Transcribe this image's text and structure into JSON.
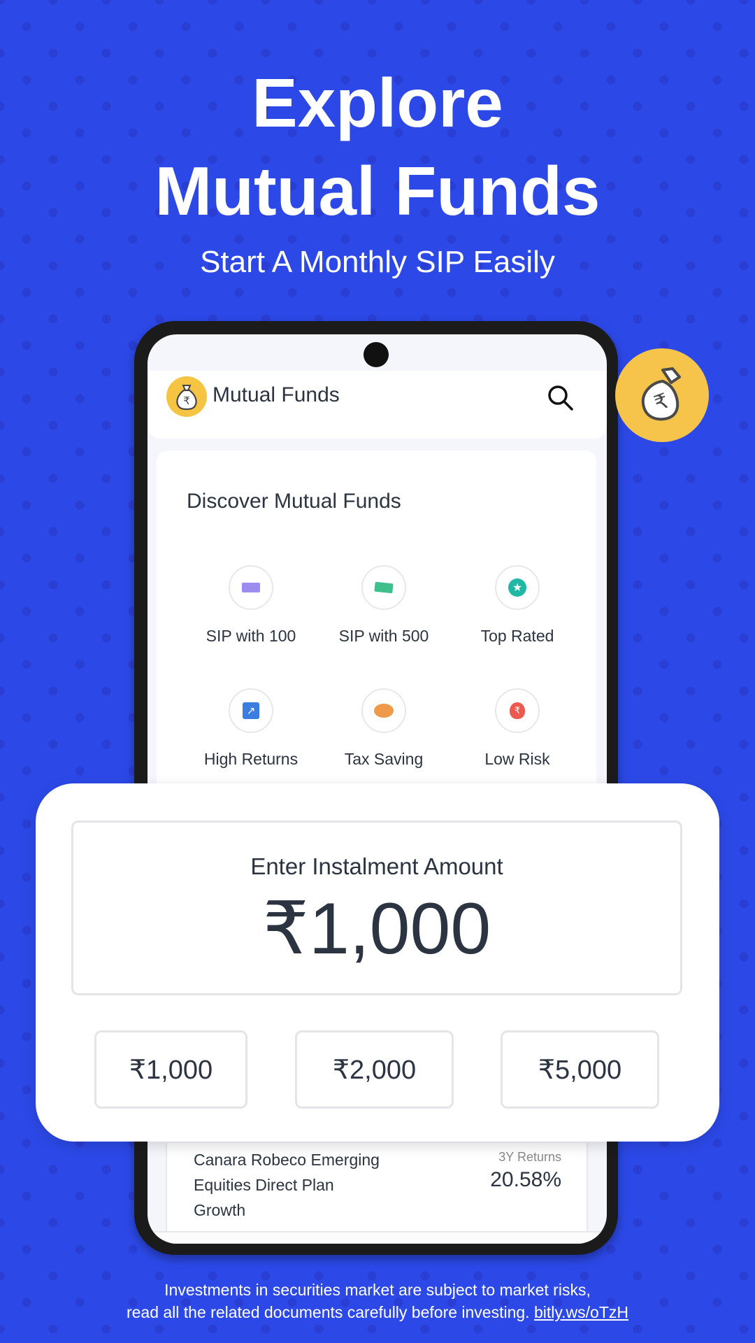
{
  "hero": {
    "title_line1": "Explore",
    "title_line2": "Mutual Funds",
    "subtitle": "Start A Monthly SIP Easily"
  },
  "app": {
    "title": "Mutual Funds",
    "discover_title": "Discover Mutual Funds",
    "categories": [
      {
        "label": "SIP with 100",
        "icon": "rupee-100-note-icon"
      },
      {
        "label": "SIP with 500",
        "icon": "rupee-500-note-icon"
      },
      {
        "label": "Top Rated",
        "icon": "star-badge-icon"
      },
      {
        "label": "High Returns",
        "icon": "trending-up-icon"
      },
      {
        "label": "Tax Saving",
        "icon": "piggy-bank-icon"
      },
      {
        "label": "Low Risk",
        "icon": "money-bag-icon"
      }
    ],
    "fund": {
      "name_line1": "Canara Robeco Emerging",
      "name_line2": "Equities Direct Plan",
      "name_line3": "Growth",
      "returns_label": "3Y Returns",
      "returns_value": "20.58%"
    }
  },
  "instalment": {
    "label": "Enter Instalment Amount",
    "amount": "₹1,000",
    "presets": [
      "₹1,000",
      "₹2,000",
      "₹5,000"
    ]
  },
  "disclaimer": {
    "line1": "Investments in securities market are subject to market risks,",
    "line2": "read all the related  documents carefully before investing.",
    "link": "bitly.ws/oTzH"
  },
  "colors": {
    "background": "#2c49e8",
    "accent_yellow": "#f5c443",
    "text_dark": "#2b3440"
  }
}
